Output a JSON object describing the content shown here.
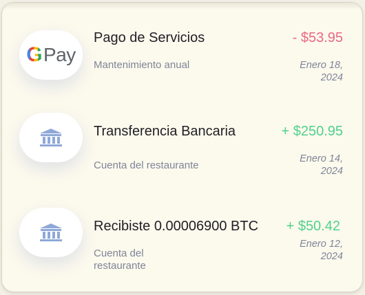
{
  "transactions": [
    {
      "icon": "gpay-icon",
      "logo_letter": "G",
      "logo_text": "Pay",
      "title": "Pago de Servicios",
      "subtitle": "Mantenimiento anual",
      "amount": "- $53.95",
      "amount_type": "debit",
      "date": "Enero 18, 2024"
    },
    {
      "icon": "bank-icon",
      "title": "Transferencia Bancaria",
      "subtitle": "Cuenta del restaurante",
      "amount": "+ $250.95",
      "amount_type": "credit",
      "date": "Enero 14, 2024"
    },
    {
      "icon": "bank-icon",
      "title": "Recibiste 0.00006900 BTC",
      "subtitle": "Cuenta del restaurante",
      "amount": "+ $50.42",
      "amount_type": "credit",
      "date": "Enero 12, 2024"
    }
  ],
  "colors": {
    "debit": "#e86a82",
    "credit": "#4fd18b",
    "bank_icon": "#8fa8d8",
    "background": "#fcf9ed"
  }
}
